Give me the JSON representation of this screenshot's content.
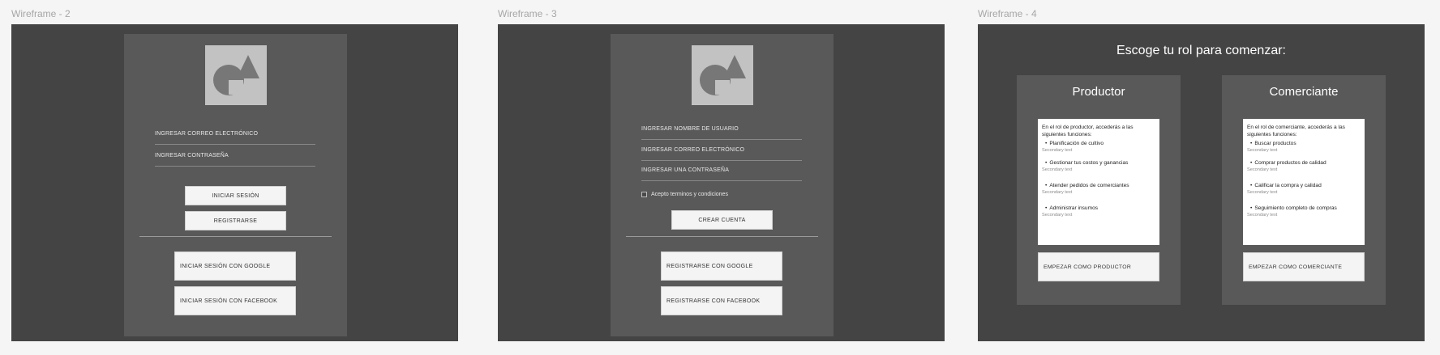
{
  "frames": [
    {
      "title": "Wireframe - 2"
    },
    {
      "title": "Wireframe - 3"
    },
    {
      "title": "Wireframe - 4"
    }
  ],
  "wf2": {
    "email_field": "INGRESAR CORREO ELECTRÓNICO",
    "password_field": "INGRESAR CONTRASEÑA",
    "login_button": "INICIAR SESIÓN",
    "register_button": "REGISTRARSE",
    "google_button": "INICIAR SESIÓN CON GOOGLE",
    "facebook_button": "INICIAR SESIÓN CON FACEBOOK"
  },
  "wf3": {
    "username_field": "INGRESAR NOMBRE DE USUARIO",
    "email_field": "INGRESAR CORREO ELECTRÓNICO",
    "password_field": "INGRESAR UNA CONTRASEÑA",
    "terms_label": "Acepto terminos y condiciones",
    "create_button": "CREAR CUENTA",
    "google_button": "REGISTRARSE CON GOOGLE",
    "facebook_button": "REGISTRARSE CON FACEBOOK"
  },
  "wf4": {
    "heading": "Escoge tu rol para comenzar:",
    "roles": [
      {
        "title": "Productor",
        "intro": "En el rol de productor, accederás a las siguientes funciones:",
        "items": [
          "Planificación de cultivo",
          "Gestionar tus costos y ganancias",
          "Atender pedidos de comerciantes",
          "Administrar insumos"
        ],
        "secondary": "Secondary text",
        "button": "EMPEZAR COMO PRODUCTOR"
      },
      {
        "title": "Comerciante",
        "intro": "En el rol de comerciante, accederás a las siguientes funciones:",
        "items": [
          "Buscar productos",
          "Comprar productos de calidad",
          "Calificar la compra y calidad",
          "Seguimiento completo de compras"
        ],
        "secondary": "Secondary text",
        "button": "EMPEZAR COMO COMERCIANTE"
      }
    ]
  },
  "colors": {
    "canvas": "#f5f5f5",
    "frame": "#444444",
    "panel": "#595959",
    "logo": "#c2c2c2",
    "logo_shapes": "#777777",
    "button": "#f4f4f4"
  },
  "icons": {
    "logo": "shapes-placeholder-icon",
    "bullet": "bullet-icon"
  }
}
